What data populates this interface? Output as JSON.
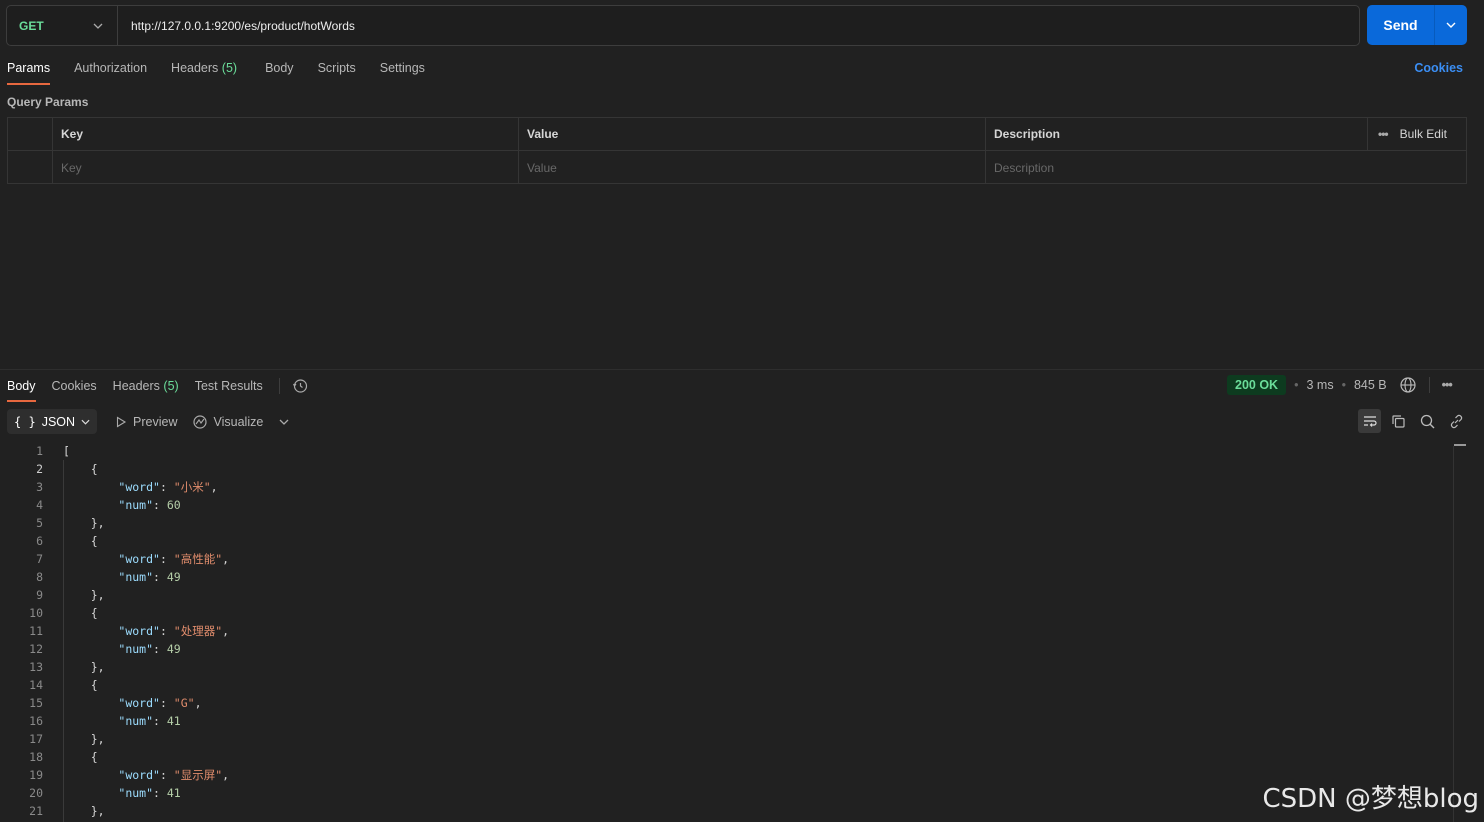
{
  "request": {
    "method": "GET",
    "url": "http://127.0.0.1:9200/es/product/hotWords",
    "send_label": "Send"
  },
  "request_tabs": [
    {
      "label": "Params",
      "count": "",
      "active": true
    },
    {
      "label": "Authorization",
      "count": ""
    },
    {
      "label": "Headers",
      "count": "(5)"
    },
    {
      "label": "Body",
      "count": ""
    },
    {
      "label": "Scripts",
      "count": ""
    },
    {
      "label": "Settings",
      "count": ""
    }
  ],
  "cookies_link": "Cookies",
  "query_params": {
    "title": "Query Params",
    "headers": {
      "key": "Key",
      "value": "Value",
      "description": "Description",
      "bulk_edit": "Bulk Edit"
    },
    "placeholders": {
      "key": "Key",
      "value": "Value",
      "description": "Description"
    }
  },
  "response_tabs": [
    {
      "label": "Body",
      "count": "",
      "active": true
    },
    {
      "label": "Cookies",
      "count": ""
    },
    {
      "label": "Headers",
      "count": "(5)"
    },
    {
      "label": "Test Results",
      "count": ""
    }
  ],
  "response_meta": {
    "status": "200 OK",
    "time": "3 ms",
    "size": "845 B"
  },
  "format": {
    "selected": "JSON",
    "brace": "{ }",
    "preview": "Preview",
    "visualize": "Visualize"
  },
  "code_lines": [
    {
      "n": "1",
      "text": "["
    },
    {
      "n": "2",
      "text": "    {"
    },
    {
      "n": "3",
      "word": "小米"
    },
    {
      "n": "4",
      "num": "60"
    },
    {
      "n": "5",
      "text": "    },"
    },
    {
      "n": "6",
      "text": "    {"
    },
    {
      "n": "7",
      "word": "高性能"
    },
    {
      "n": "8",
      "num": "49"
    },
    {
      "n": "9",
      "text": "    },"
    },
    {
      "n": "10",
      "text": "    {"
    },
    {
      "n": "11",
      "word": "处理器"
    },
    {
      "n": "12",
      "num": "49"
    },
    {
      "n": "13",
      "text": "    },"
    },
    {
      "n": "14",
      "text": "    {"
    },
    {
      "n": "15",
      "word": "G"
    },
    {
      "n": "16",
      "num": "41"
    },
    {
      "n": "17",
      "text": "    },"
    },
    {
      "n": "18",
      "text": "    {"
    },
    {
      "n": "19",
      "word": "显示屏"
    },
    {
      "n": "20",
      "num": "41"
    },
    {
      "n": "21",
      "text": "    },"
    }
  ],
  "json_keys": {
    "word": "\"word\"",
    "num": "\"num\""
  },
  "watermark": "CSDN @梦想blog",
  "colors": {
    "accent": "#e7683f",
    "send": "#0a69da",
    "success": "#6bdd9a",
    "link": "#3b8ef3"
  }
}
